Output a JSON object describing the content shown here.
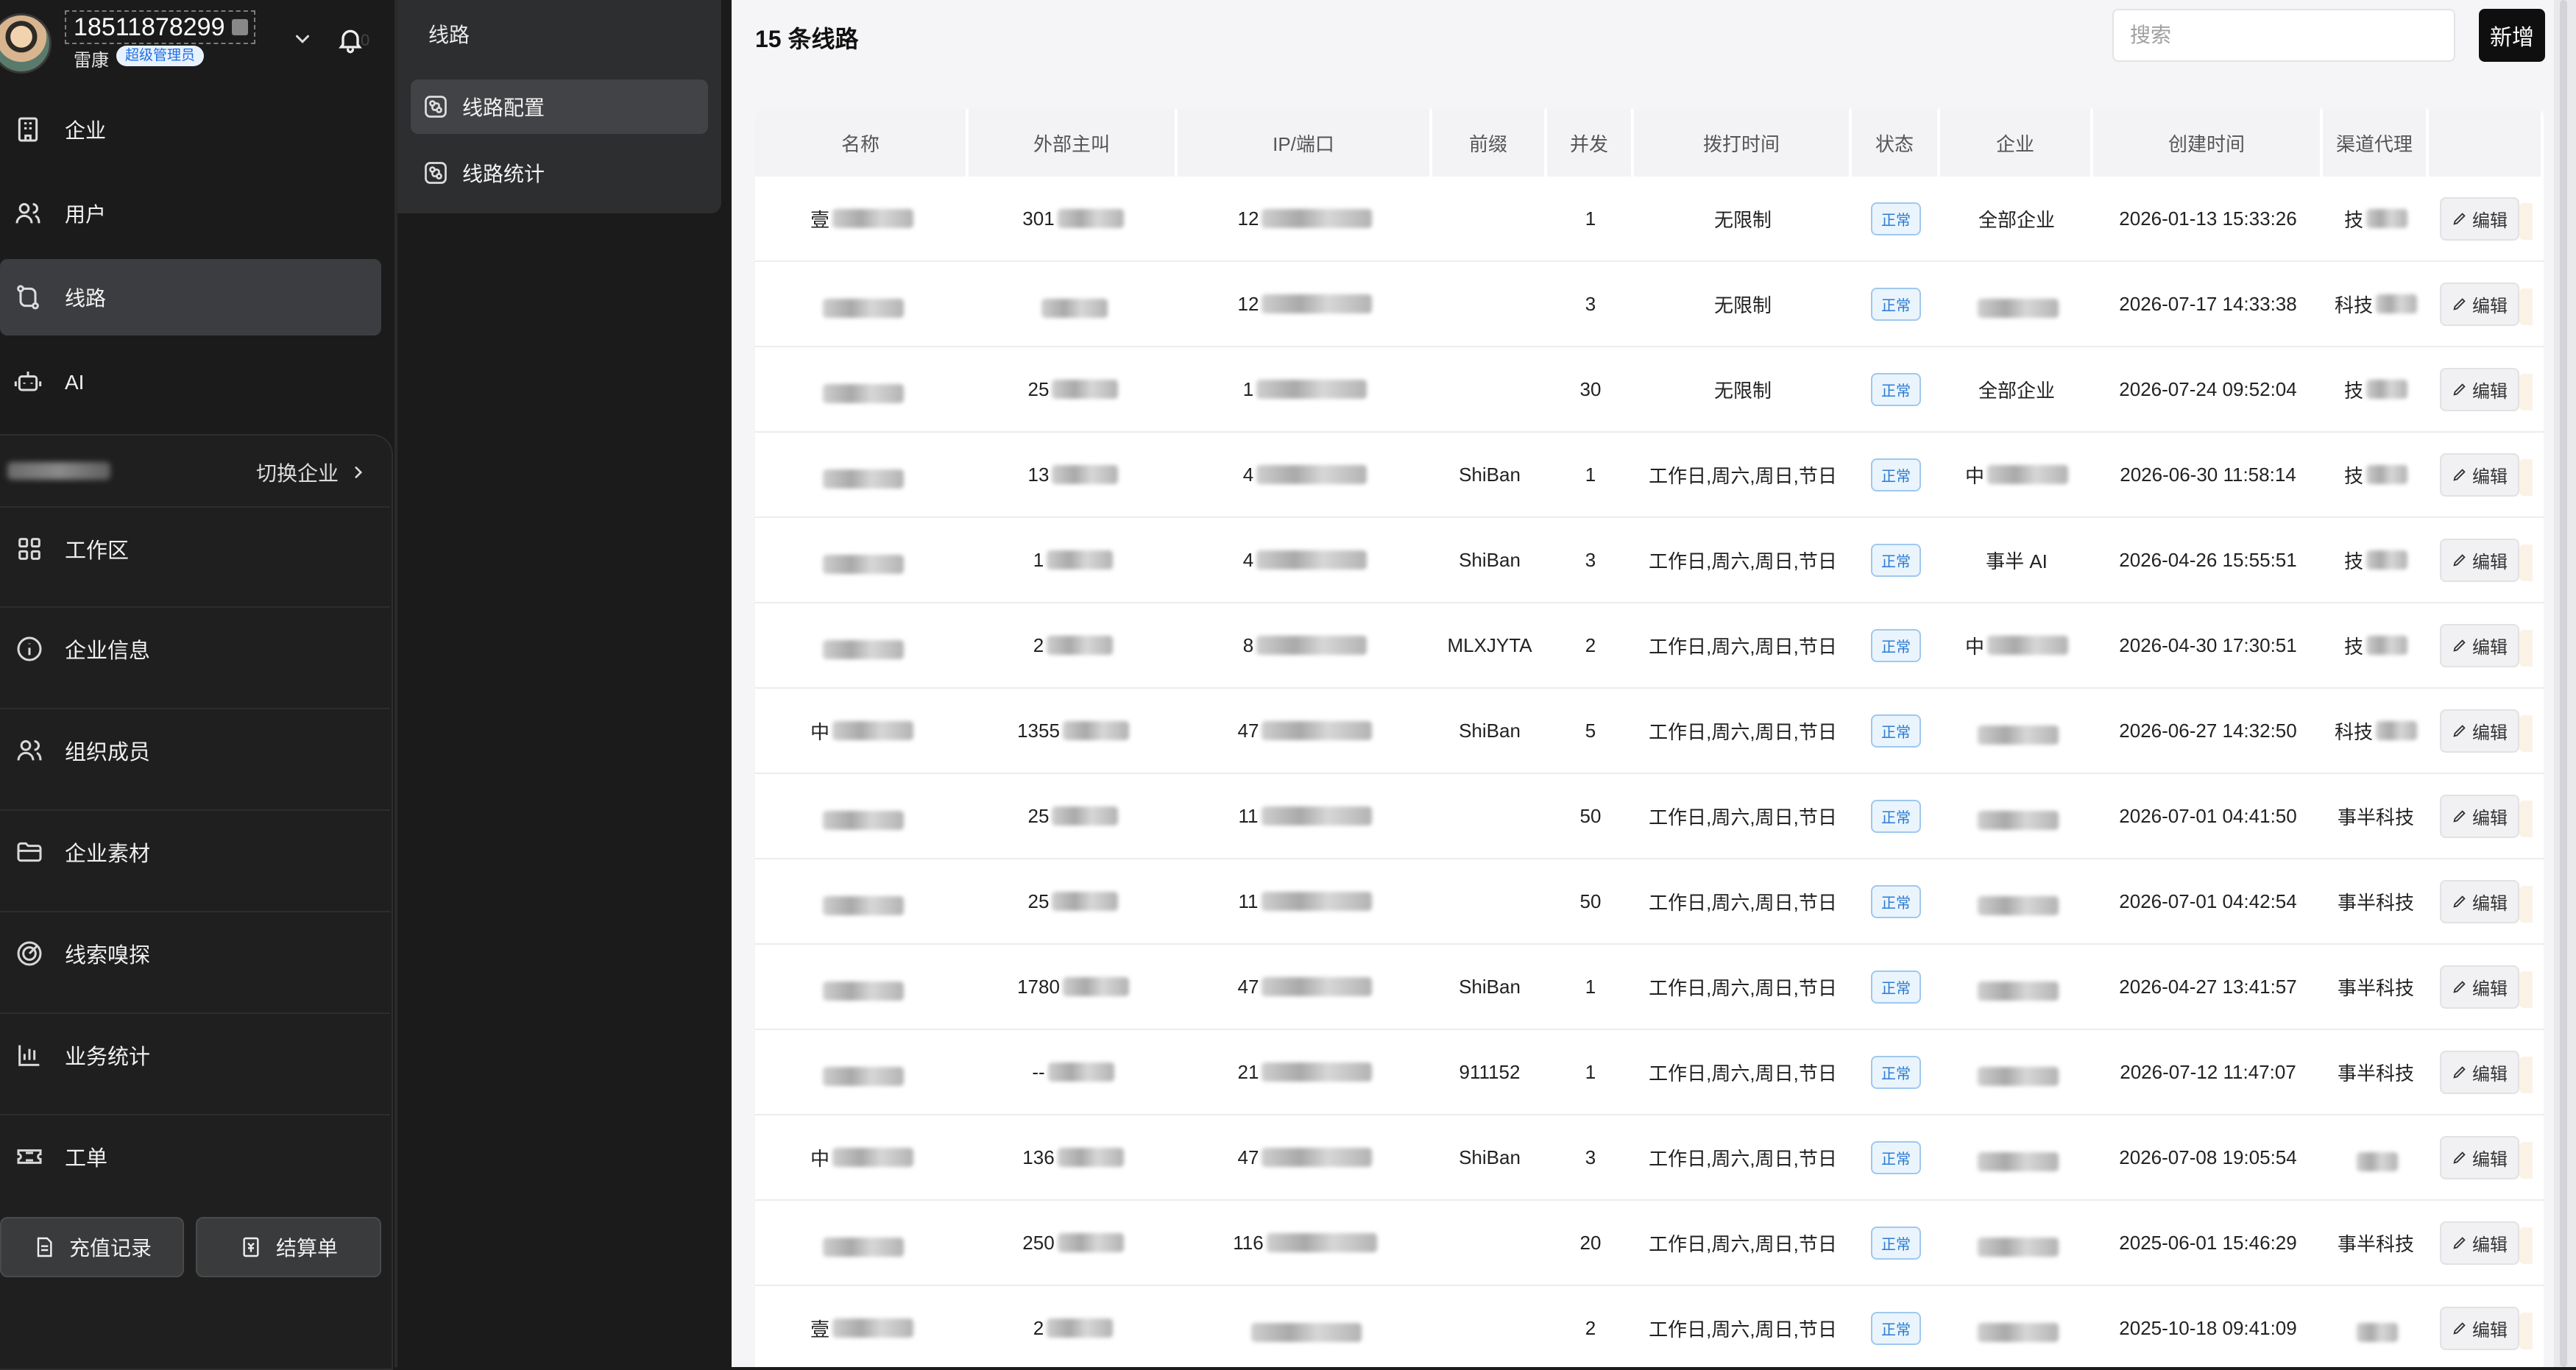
{
  "user": {
    "phone": "18511878299",
    "name": "雷康",
    "role": "超级管理员"
  },
  "nav": [
    {
      "key": "company",
      "label": "企业",
      "icon": "building-icon"
    },
    {
      "key": "users",
      "label": "用户",
      "icon": "users-icon"
    },
    {
      "key": "lines",
      "label": "线路",
      "icon": "route-icon",
      "active": true
    },
    {
      "key": "ai",
      "label": "AI",
      "icon": "robot-icon"
    }
  ],
  "enterprise": {
    "switch_label": "切换企业",
    "items": [
      {
        "label": "工作区",
        "icon": "grid-icon"
      },
      {
        "label": "企业信息",
        "icon": "info-icon"
      },
      {
        "label": "组织成员",
        "icon": "members-icon"
      },
      {
        "label": "企业素材",
        "icon": "folder-icon"
      },
      {
        "label": "线索嗅探",
        "icon": "radar-icon"
      },
      {
        "label": "业务统计",
        "icon": "bar-chart-icon"
      },
      {
        "label": "工单",
        "icon": "ticket-icon"
      }
    ],
    "buttons": {
      "recharge": "充值记录",
      "settlement": "结算单"
    }
  },
  "submenu": {
    "title": "线路",
    "items": [
      {
        "label": "线路配置",
        "active": true
      },
      {
        "label": "线路统计",
        "active": false
      }
    ]
  },
  "main": {
    "title": "15 条线路",
    "search_placeholder": "搜索",
    "add_label": "新增",
    "columns": [
      "名称",
      "外部主叫",
      "IP/端口",
      "前缀",
      "并发",
      "拨打时间",
      "状态",
      "企业",
      "创建时间",
      "渠道代理",
      ""
    ],
    "edit_label": "编辑",
    "rows": [
      {
        "name": "壹",
        "caller": "301",
        "ip": "12",
        "prefix": "",
        "conc": "1",
        "time": "无限制",
        "status": "正常",
        "ent": "全部企业",
        "created": "2026-01-13 15:33:26",
        "agent": "技"
      },
      {
        "name": "",
        "caller": "",
        "ip": "12",
        "prefix": "",
        "conc": "3",
        "time": "无限制",
        "status": "正常",
        "ent": "",
        "created": "2026-07-17 14:33:38",
        "agent": "科技"
      },
      {
        "name": "",
        "caller": "25",
        "ip": "1",
        "prefix": "",
        "conc": "30",
        "time": "无限制",
        "status": "正常",
        "ent": "全部企业",
        "created": "2026-07-24 09:52:04",
        "agent": "技"
      },
      {
        "name": "",
        "caller": "13",
        "ip": "4",
        "prefix": "ShiBan",
        "conc": "1",
        "time": "工作日,周六,周日,节日",
        "status": "正常",
        "ent": "中",
        "created": "2026-06-30 11:58:14",
        "agent": "技"
      },
      {
        "name": "",
        "caller": "1",
        "ip": "4",
        "prefix": "ShiBan",
        "conc": "3",
        "time": "工作日,周六,周日,节日",
        "status": "正常",
        "ent": "事半 AI",
        "created": "2026-04-26 15:55:51",
        "agent": "技"
      },
      {
        "name": "",
        "caller": "2",
        "ip": "8",
        "prefix": "MLXJYTA",
        "conc": "2",
        "time": "工作日,周六,周日,节日",
        "status": "正常",
        "ent": "中",
        "created": "2026-04-30 17:30:51",
        "agent": "技"
      },
      {
        "name": "中",
        "caller": "1355",
        "ip": "47",
        "prefix": "ShiBan",
        "conc": "5",
        "time": "工作日,周六,周日,节日",
        "status": "正常",
        "ent": "",
        "created": "2026-06-27 14:32:50",
        "agent": "科技"
      },
      {
        "name": "",
        "caller": "25",
        "ip": "11",
        "prefix": "",
        "conc": "50",
        "time": "工作日,周六,周日,节日",
        "status": "正常",
        "ent": "",
        "created": "2026-07-01 04:41:50",
        "agent": "事半科技"
      },
      {
        "name": "",
        "caller": "25",
        "ip": "11",
        "prefix": "",
        "conc": "50",
        "time": "工作日,周六,周日,节日",
        "status": "正常",
        "ent": "",
        "created": "2026-07-01 04:42:54",
        "agent": "事半科技"
      },
      {
        "name": "",
        "caller": "1780",
        "ip": "47",
        "prefix": "ShiBan",
        "conc": "1",
        "time": "工作日,周六,周日,节日",
        "status": "正常",
        "ent": "",
        "created": "2026-04-27 13:41:57",
        "agent": "事半科技"
      },
      {
        "name": "",
        "caller": "--",
        "ip": "21",
        "prefix": "911152",
        "conc": "1",
        "time": "工作日,周六,周日,节日",
        "status": "正常",
        "ent": "",
        "created": "2026-07-12 11:47:07",
        "agent": "事半科技"
      },
      {
        "name": "中",
        "caller": "136",
        "ip": "47",
        "prefix": "ShiBan",
        "conc": "3",
        "time": "工作日,周六,周日,节日",
        "status": "正常",
        "ent": "",
        "created": "2026-07-08 19:05:54",
        "agent": ""
      },
      {
        "name": "",
        "caller": "250",
        "ip": "116",
        "prefix": "",
        "conc": "20",
        "time": "工作日,周六,周日,节日",
        "status": "正常",
        "ent": "",
        "created": "2025-06-01 15:46:29",
        "agent": "事半科技"
      },
      {
        "name": "壹",
        "caller": "2",
        "ip": "",
        "prefix": "",
        "conc": "2",
        "time": "工作日,周六,周日,节日",
        "status": "正常",
        "ent": "",
        "created": "2025-10-18 09:41:09",
        "agent": ""
      }
    ]
  }
}
